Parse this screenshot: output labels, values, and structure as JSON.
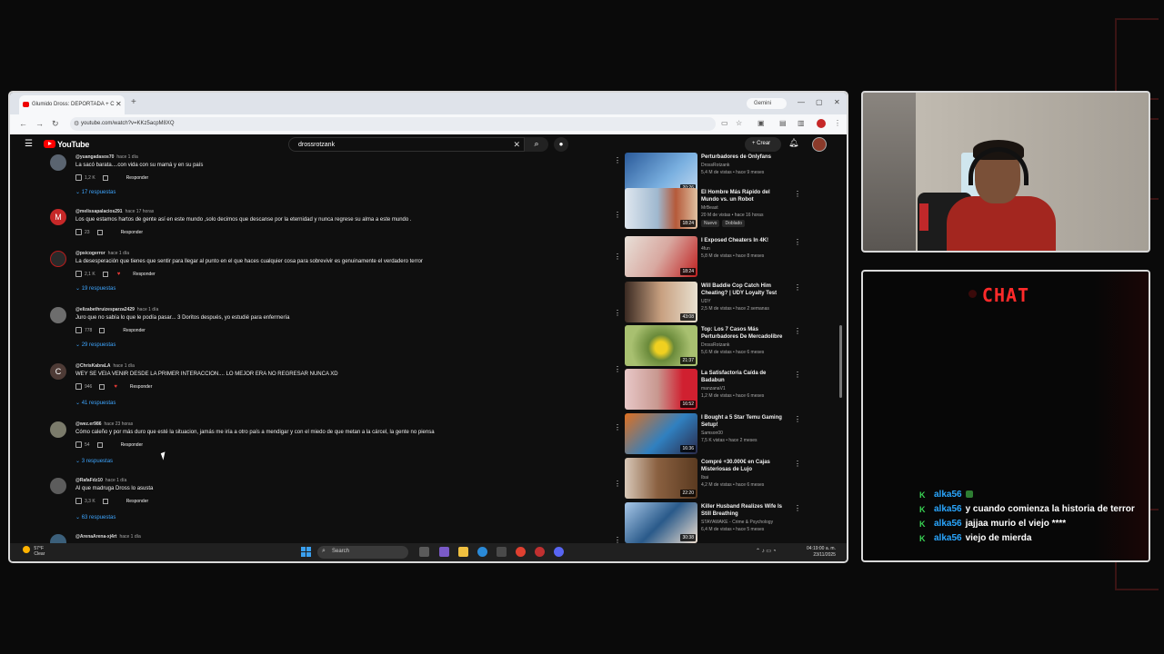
{
  "browser": {
    "tab_title": "Glumido Dross: DEPORTADA + C",
    "tab_close": "✕",
    "new_tab": "+",
    "gemini": "Gemini",
    "url": "youtube.com/watch?v=KKz5acpM8XQ",
    "controls": {
      "minimize": "—",
      "maximize": "▢",
      "close": "✕"
    }
  },
  "youtube": {
    "logo_text": "YouTube",
    "search_value": "drossrotzank",
    "create_label": "Crear",
    "reply_label": "Responder"
  },
  "comments": [
    {
      "initial": "",
      "handle": "@yuangadasos70",
      "time": "hace 1 día",
      "text": "La sacó  barata....con vida con su mamá  y en su país",
      "likes": "1,2 K",
      "replies": "17 respuestas",
      "heart": false
    },
    {
      "initial": "M",
      "handle": "@melissapalacios291",
      "time": "hace 17 horas",
      "text": "Los que estamos hartos de gente así en este mundo  ,solo decimos que descanse por la eternidad y nunca regrese su alma a este mundo .",
      "likes": "23",
      "replies": "",
      "heart": false
    },
    {
      "initial": "",
      "handle": "@psicogerror",
      "time": "hace 1 día",
      "text": "La desesperación que tienes que sentir para llegar al punto en el que haces cualquier cosa para sobrevivir es genuinamente el verdadero terror",
      "likes": "2,1 K",
      "replies": "19 respuestas",
      "heart": true
    },
    {
      "initial": "",
      "handle": "@elizabethruizesparza2429",
      "time": "hace 1 día",
      "text": "Juro que no sabía lo que le podía pasar... 3 Doritos después, yo estudié para enfermería",
      "likes": "778",
      "replies": "29 respuestas",
      "heart": false
    },
    {
      "initial": "C",
      "handle": "@ChrisKabraLA",
      "time": "hace 1 día",
      "text": "WEY SE VEIA VENIR DESDE LA PRIMER INTERACCION.... LO MEJOR ERA NO REGRESAR NUNCA XD",
      "likes": "946",
      "replies": "41 respuestas",
      "heart": true
    },
    {
      "initial": "",
      "handle": "@wez.er986",
      "time": "hace 23 horas",
      "text": "Cómo caleño y por más duro que esté la situacion, jamás me iría a otro país a mendigar y con el miedo de que metan a la cárcel, la gente no piensa",
      "likes": "54",
      "replies": "3 respuestas",
      "heart": false
    },
    {
      "initial": "",
      "handle": "@RafaFdz10",
      "time": "hace 1 día",
      "text": "Al que madruga Dross lo asusta",
      "likes": "3,3 K",
      "replies": "63 respuestas",
      "heart": false
    },
    {
      "initial": "",
      "handle": "@ArenaArena-xj4rt",
      "time": "hace 1 día",
      "text": "",
      "likes": "",
      "replies": "",
      "heart": false
    }
  ],
  "recommended": [
    {
      "title": "Perturbadores de Onlyfans",
      "channel": "DrossRotzank",
      "meta": "5,4 M de vistas • hace 9 meses",
      "duration": "20:26",
      "badges": []
    },
    {
      "title": "El Hombre Más Rápido del Mundo vs. un Robot",
      "channel": "MrBeast",
      "meta": "20 M de vistas • hace 16 horas",
      "duration": "18:24",
      "badges": [
        "Nuevo",
        "Doblado"
      ]
    },
    {
      "title": "I Exposed Cheaters In 4K!",
      "channel": "4fun",
      "meta": "5,8 M de vistas • hace 8 meses",
      "duration": "18:24",
      "badges": []
    },
    {
      "title": "Will Baddie Cop Catch Him Cheating? | UDY Loyalty Test",
      "channel": "UDY",
      "meta": "2,5 M de vistas • hace 2 semanas",
      "duration": "43:08",
      "badges": []
    },
    {
      "title": "Top: Los 7 Casos Más Perturbadores De Mercadolibre",
      "channel": "DrossRotzank",
      "meta": "5,6 M de vistas • hace 6 meses",
      "duration": "21:37",
      "badges": []
    },
    {
      "title": "La Satisfactoria Caída de Badabun",
      "channel": "manzanaV1",
      "meta": "1,2 M de vistas • hace 6 meses",
      "duration": "16:52",
      "badges": []
    },
    {
      "title": "I Bought a 5 Star Temu Gaming Setup!",
      "channel": "Samson00",
      "meta": "7,5 K vistas • hace 2 meses",
      "duration": "16:36",
      "badges": []
    },
    {
      "title": "Compré +30.000€ en Cajas Misteriosas de Lujo",
      "channel": "Ibai",
      "meta": "4,2 M de vistas • hace 6 meses",
      "duration": "22:20",
      "badges": []
    },
    {
      "title": "Killer Husband Realizes Wife Is Still Breathing",
      "channel": "STAYAWAKE - Crime & Psychology",
      "meta": "6,4 M de vistas • hace 5 meses",
      "duration": "30:38",
      "badges": []
    }
  ],
  "taskbar": {
    "temp": "57°F",
    "weather": "Clear",
    "search_placeholder": "Search",
    "time": "04:19:00 a. m.",
    "date": "23/11/2025"
  },
  "chat": {
    "title": "CHAT",
    "messages": [
      {
        "user": "alka56",
        "text": ""
      },
      {
        "user": "alka56",
        "text": "y cuando comienza la historia de terror"
      },
      {
        "user": "alka56",
        "text": "jajjaa murio el viejo ****"
      },
      {
        "user": "alka56",
        "text": "viejo de mierda"
      }
    ]
  },
  "colors": {
    "accent_red": "#ff2a2a",
    "link_blue": "#3ea6ff",
    "chat_user": "#2aa7ff",
    "kick_green": "#39d353"
  }
}
